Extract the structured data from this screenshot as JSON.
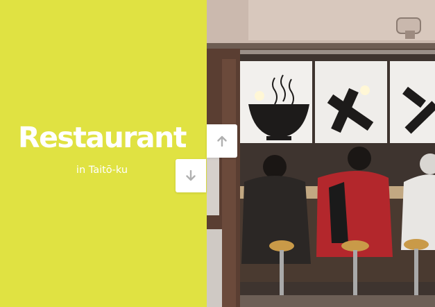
{
  "hero": {
    "title": "Restaurant",
    "subtitle": "in Taitō-ku"
  },
  "navigation": {
    "up_icon": "arrow-up-icon",
    "down_icon": "arrow-down-icon"
  },
  "colors": {
    "accent": "#e0e242",
    "text": "#ffffff",
    "button": "#ffffff",
    "icon": "#b0b0b0"
  }
}
